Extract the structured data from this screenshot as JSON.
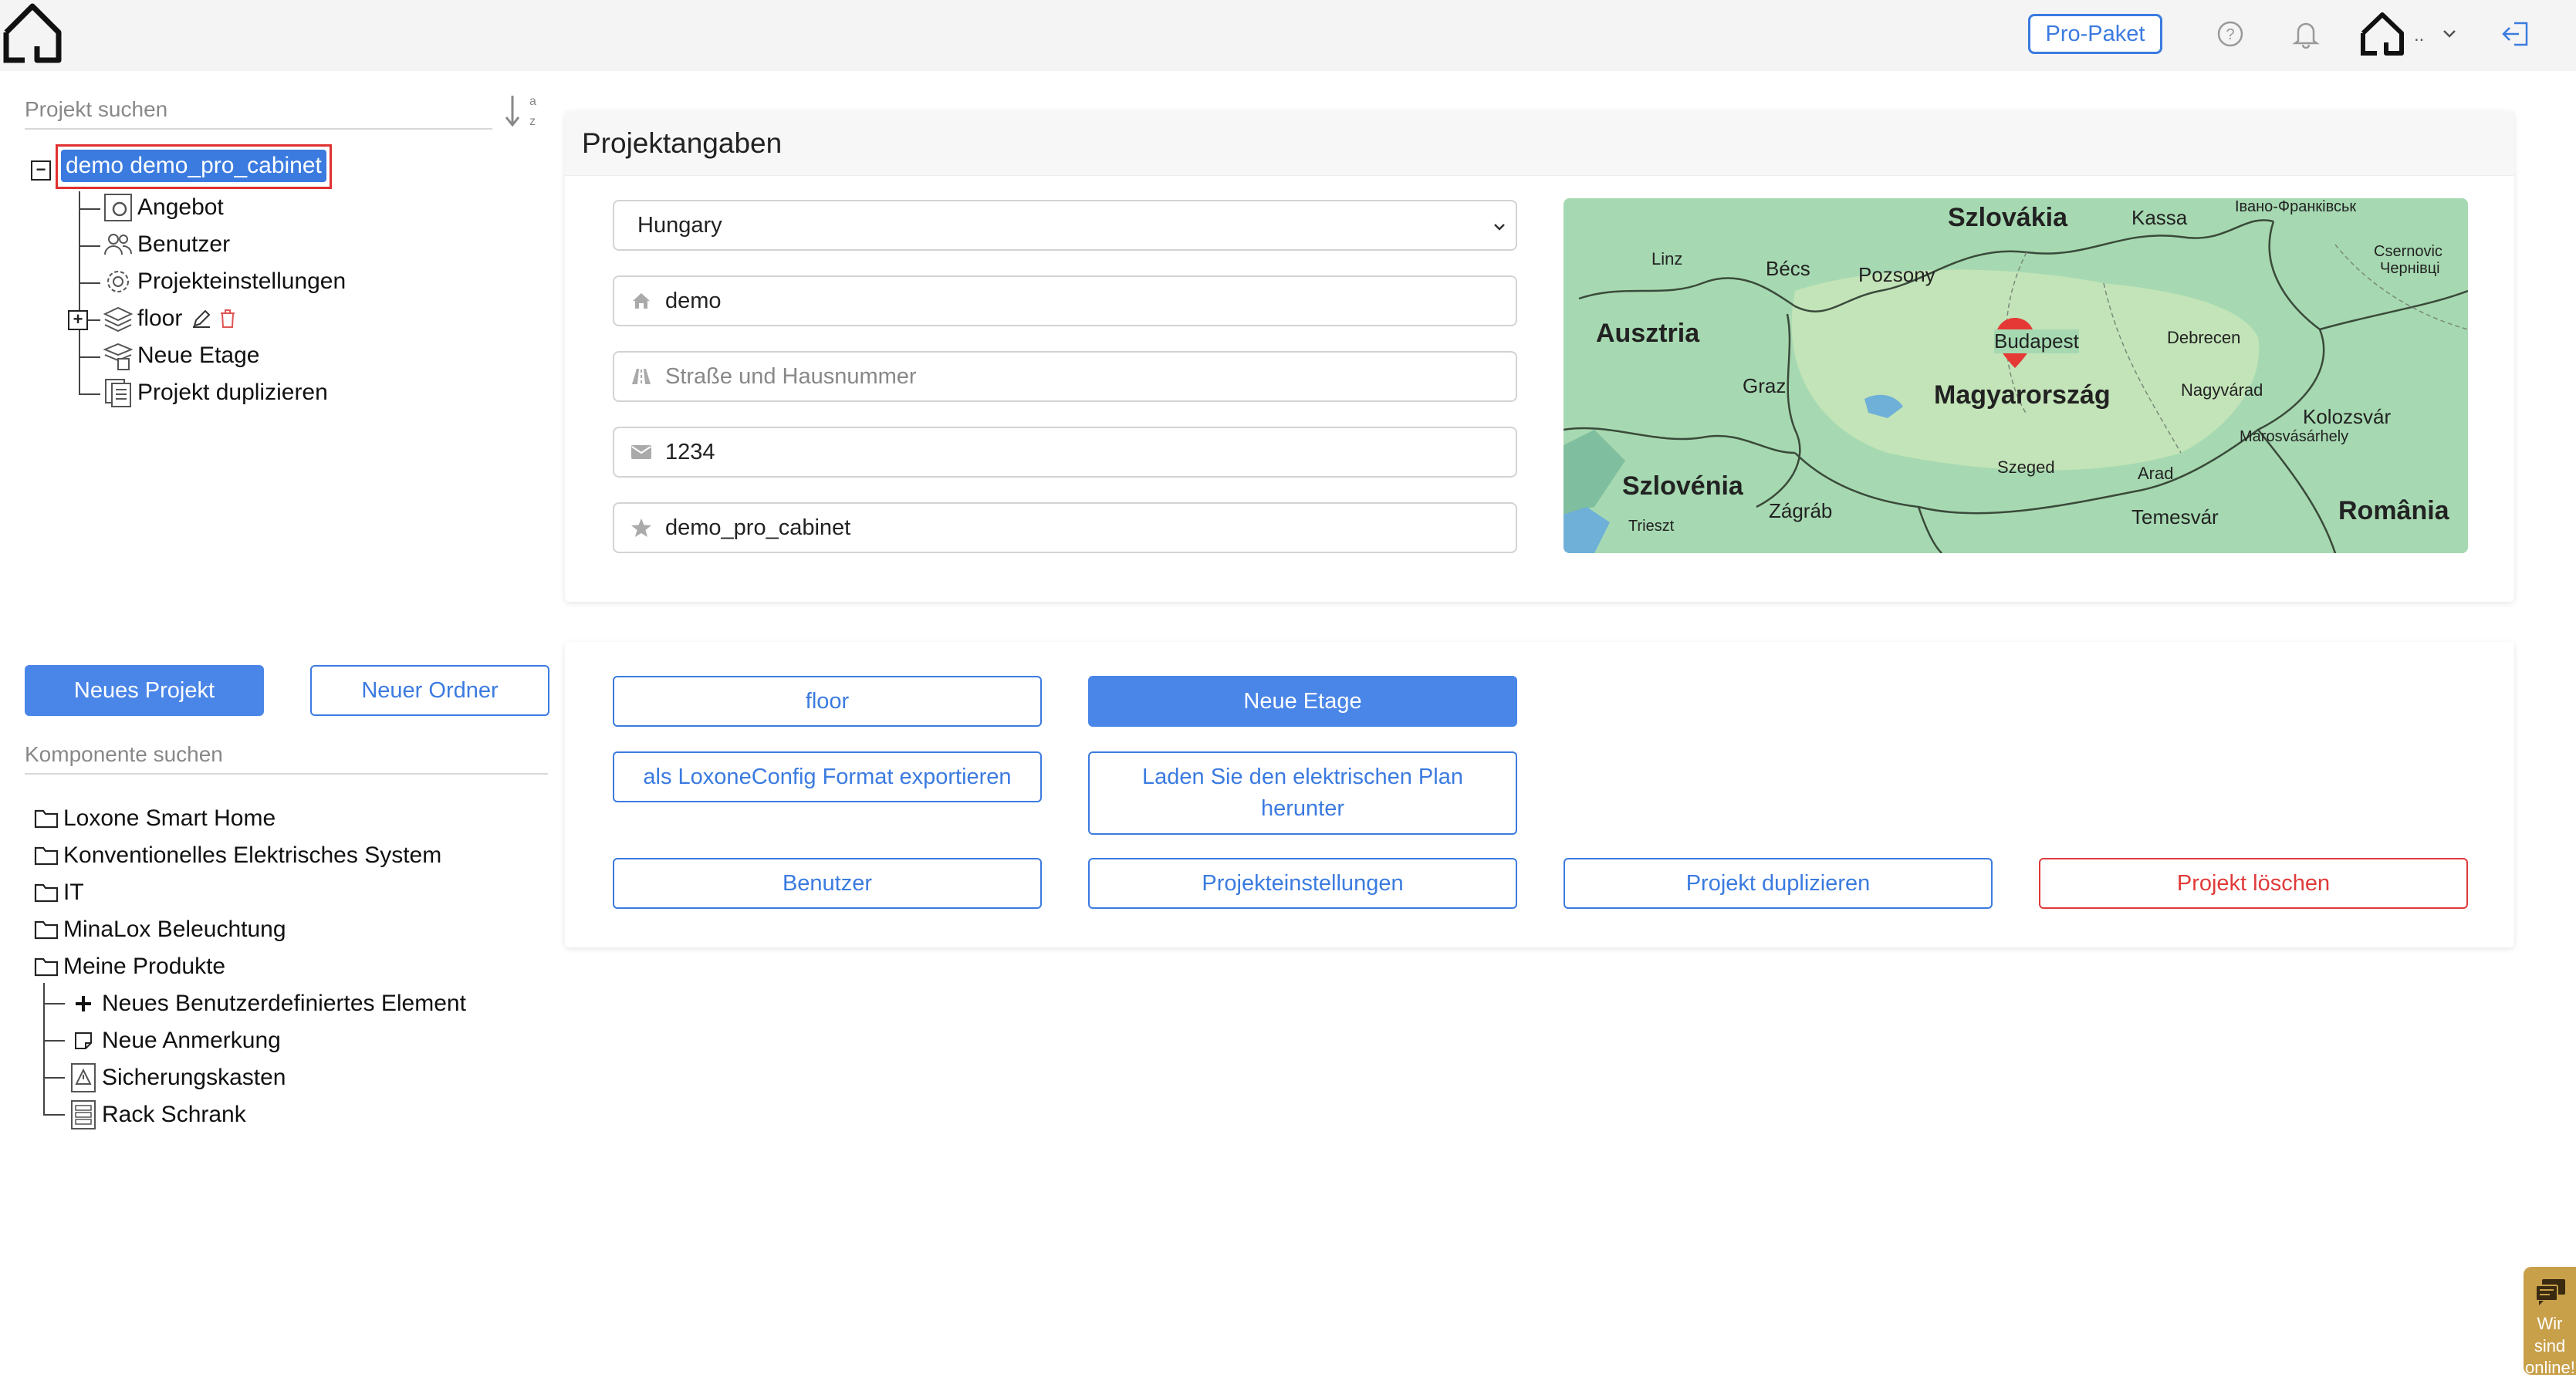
{
  "topbar": {
    "pro_label": "Pro-Paket",
    "user_label": "..",
    "icons": [
      "home-icon",
      "help-icon",
      "bell-icon",
      "user-home-icon",
      "logout-icon"
    ]
  },
  "project_search": {
    "placeholder": "Projekt suchen"
  },
  "project_tree": {
    "root_label": "demo demo_pro_cabinet",
    "items": [
      {
        "label": "Angebot",
        "icon": "offer-gear-icon"
      },
      {
        "label": "Benutzer",
        "icon": "users-icon"
      },
      {
        "label": "Projekteinstellungen",
        "icon": "gear-icon"
      },
      {
        "label": "floor",
        "icon": "layers-icon"
      },
      {
        "label": "Neue Etage",
        "icon": "add-layer-icon"
      },
      {
        "label": "Projekt duplizieren",
        "icon": "duplicate-icon"
      }
    ]
  },
  "left_buttons": {
    "new_project": "Neues Projekt",
    "new_folder": "Neuer Ordner"
  },
  "component_search": {
    "placeholder": "Komponente suchen"
  },
  "component_tree": {
    "folders": [
      "Loxone Smart Home",
      "Konventionelles Elektrisches System",
      "IT",
      "MinaLox Beleuchtung",
      "Meine Produkte"
    ],
    "my_products": [
      {
        "label": "Neues Benutzerdefiniertes Element",
        "icon": "plus-icon"
      },
      {
        "label": "Neue Anmerkung",
        "icon": "note-icon"
      },
      {
        "label": "Sicherungskasten",
        "icon": "fusebox-icon"
      },
      {
        "label": "Rack Schrank",
        "icon": "rack-icon"
      }
    ]
  },
  "project_info": {
    "title": "Projektangaben",
    "country": "Hungary",
    "name": "demo",
    "street_placeholder": "Straße und Hausnummer",
    "zip": "1234",
    "project_name": "demo_pro_cabinet"
  },
  "map": {
    "labels": {
      "slovakia": "Szlovákia",
      "kassa": "Kassa",
      "ivano": "Івано-Франківськ",
      "linz": "Linz",
      "becs": "Bécs",
      "pozsony": "Pozsony",
      "csernovic": "Csernovic",
      "chernivtsi": "Чернівці",
      "austria": "Ausztria",
      "budapest": "Budapest",
      "debrecen": "Debrecen",
      "graz": "Graz",
      "hungary": "Magyarország",
      "nagyvarad": "Nagyvárad",
      "kolozsvar": "Kolozsvár",
      "marosvasarhely": "Marosvásárhely",
      "szeged": "Szeged",
      "arad": "Arad",
      "slovenia": "Szlovénia",
      "zagrab": "Zágráb",
      "trieszt": "Trieszt",
      "temesvar": "Temesvár",
      "romania": "România"
    }
  },
  "actions": {
    "floor": "floor",
    "new_floor": "Neue Etage",
    "export": "als LoxoneConfig Format exportieren",
    "download_plan": "Laden Sie den elektrischen Plan herunter",
    "users": "Benutzer",
    "settings": "Projekteinstellungen",
    "duplicate": "Projekt duplizieren",
    "delete": "Projekt löschen"
  },
  "chat": {
    "label": "Wir sind online!"
  },
  "colors": {
    "accent": "#3b7be0",
    "danger": "#e03a3a",
    "chat": "#c8a04a",
    "map_land": "#9fd5ac"
  }
}
